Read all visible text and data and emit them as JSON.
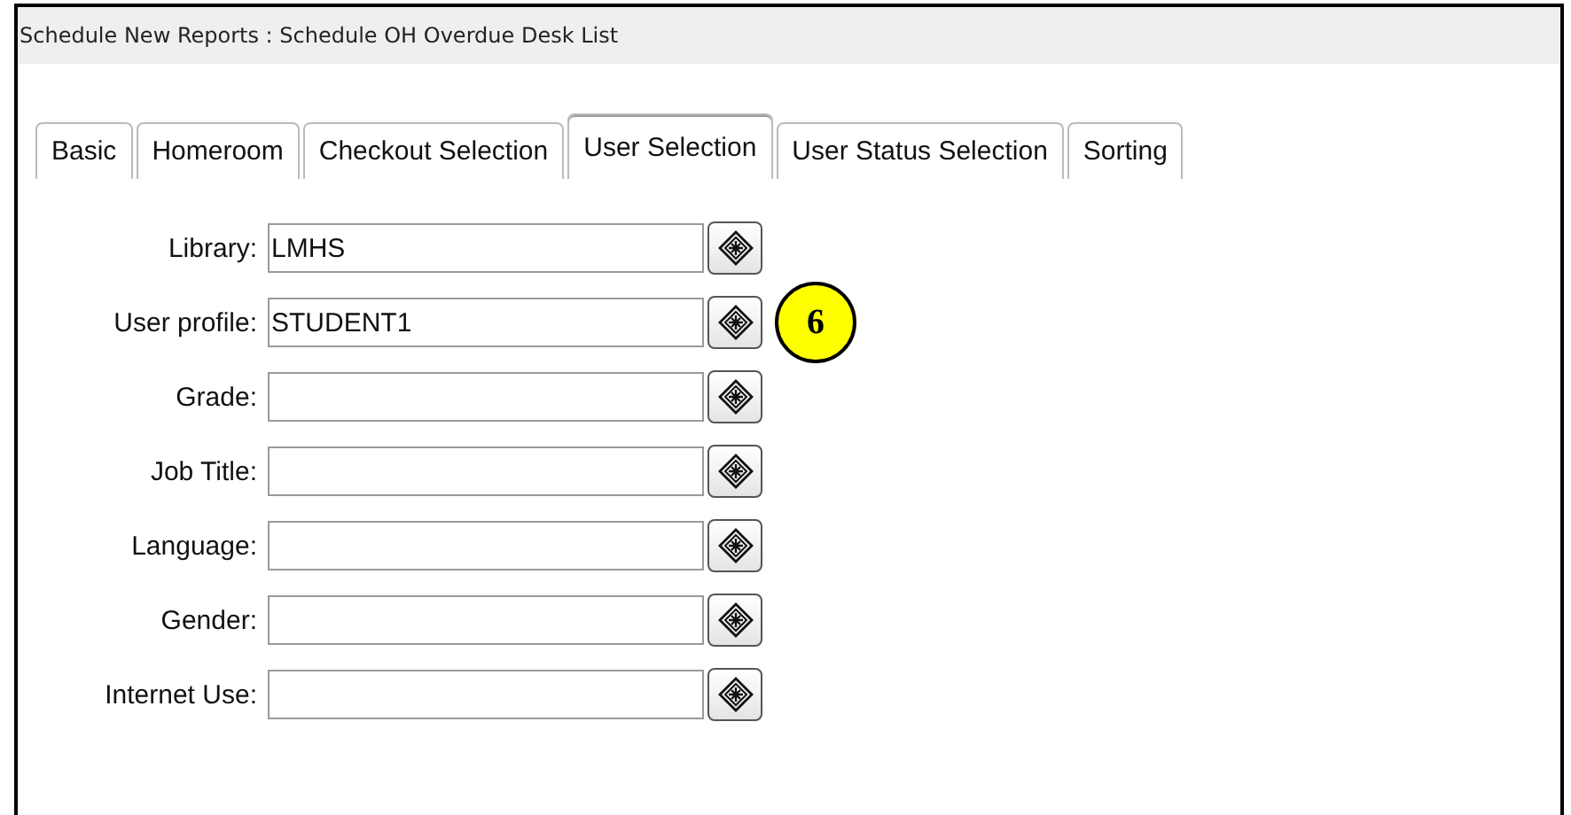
{
  "window": {
    "title": "Schedule New Reports : Schedule OH Overdue Desk List"
  },
  "tabs": [
    {
      "label": "Basic",
      "selected": false
    },
    {
      "label": "Homeroom",
      "selected": false
    },
    {
      "label": "Checkout Selection",
      "selected": false
    },
    {
      "label": "User Selection",
      "selected": true
    },
    {
      "label": "User Status Selection",
      "selected": false
    },
    {
      "label": "Sorting",
      "selected": false
    }
  ],
  "fields": [
    {
      "label": "Library:",
      "value": "LMHS"
    },
    {
      "label": "User profile:",
      "value": "STUDENT1",
      "callout": "6"
    },
    {
      "label": "Grade:"
    },
    {
      "label": "Job Title:"
    },
    {
      "label": "Language:"
    },
    {
      "label": "Gender:"
    },
    {
      "label": "Internet Use:"
    }
  ]
}
